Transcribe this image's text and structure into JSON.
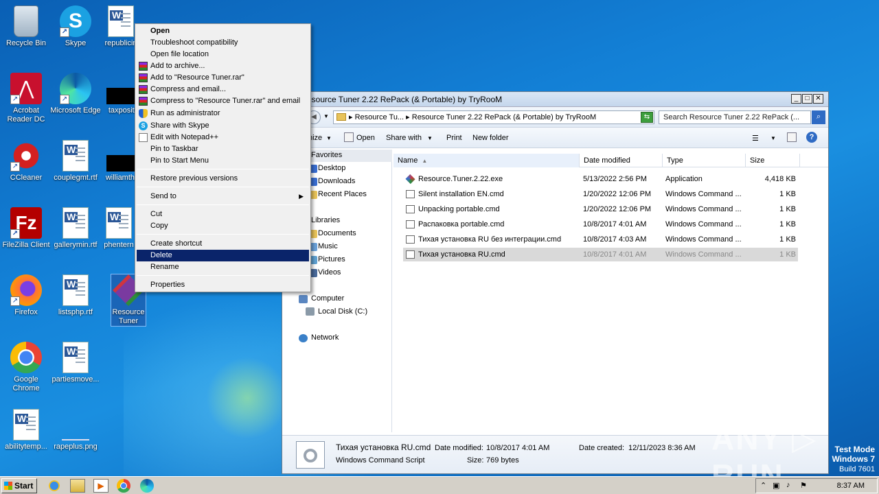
{
  "desktop": {
    "icons": [
      {
        "label": "Recycle Bin"
      },
      {
        "label": "Skype"
      },
      {
        "label": "republicin"
      },
      {
        "label": "Acrobat Reader DC"
      },
      {
        "label": "Microsoft Edge"
      },
      {
        "label": "taxpositi"
      },
      {
        "label": "CCleaner"
      },
      {
        "label": "couplegmt.rtf"
      },
      {
        "label": "williamthe"
      },
      {
        "label": "FileZilla Client"
      },
      {
        "label": "gallerymin.rtf"
      },
      {
        "label": "phentern"
      },
      {
        "label": "Firefox"
      },
      {
        "label": "listsphp.rtf"
      },
      {
        "label": "Resource Tuner"
      },
      {
        "label": "Google Chrome"
      },
      {
        "label": "partiesmove..."
      },
      {
        "label": "abilitytemp..."
      },
      {
        "label": "rapeplus.png"
      }
    ]
  },
  "context_menu": {
    "items": [
      {
        "label": "Open"
      },
      {
        "label": "Troubleshoot compatibility"
      },
      {
        "label": "Open file location"
      },
      {
        "label": "Add to archive..."
      },
      {
        "label": "Add to \"Resource Tuner.rar\""
      },
      {
        "label": "Compress and email..."
      },
      {
        "label": "Compress to \"Resource Tuner.rar\" and email"
      },
      {
        "label": "Run as administrator"
      },
      {
        "label": "Share with Skype"
      },
      {
        "label": "Edit with Notepad++"
      },
      {
        "label": "Pin to Taskbar"
      },
      {
        "label": "Pin to Start Menu"
      },
      {
        "label": "Restore previous versions"
      },
      {
        "label": "Send to"
      },
      {
        "label": "Cut"
      },
      {
        "label": "Copy"
      },
      {
        "label": "Create shortcut"
      },
      {
        "label": "Delete"
      },
      {
        "label": "Rename"
      },
      {
        "label": "Properties"
      }
    ]
  },
  "explorer": {
    "title": "esource Tuner 2.22 RePack (& Portable) by TryRooM",
    "address": "▸ Resource Tu... ▸ Resource Tuner 2.22 RePack (& Portable) by TryRooM",
    "search_placeholder": "Search Resource Tuner 2.22 RePack (...",
    "toolbar": {
      "organize": "nize",
      "open": "Open",
      "share": "Share with",
      "print": "Print",
      "new_folder": "New folder"
    },
    "nav": {
      "favorites": "Favorites",
      "desktop": "Desktop",
      "downloads": "Downloads",
      "recent": "Recent Places",
      "libraries": "Libraries",
      "documents": "Documents",
      "music": "Music",
      "pictures": "Pictures",
      "videos": "Videos",
      "computer": "Computer",
      "local_disk": "Local Disk (C:)",
      "network": "Network"
    },
    "columns": {
      "name": "Name",
      "date": "Date modified",
      "type": "Type",
      "size": "Size"
    },
    "files": [
      {
        "name": "Resource.Tuner.2.22.exe",
        "date": "5/13/2022 2:56 PM",
        "type": "Application",
        "size": "4,418 KB"
      },
      {
        "name": "Silent installation EN.cmd",
        "date": "1/20/2022 12:06 PM",
        "type": "Windows Command ...",
        "size": "1 KB"
      },
      {
        "name": "Unpacking portable.cmd",
        "date": "1/20/2022 12:06 PM",
        "type": "Windows Command ...",
        "size": "1 KB"
      },
      {
        "name": "Распаковка portable.cmd",
        "date": "10/8/2017 4:01 AM",
        "type": "Windows Command ...",
        "size": "1 KB"
      },
      {
        "name": "Тихая установка RU без интеграции.cmd",
        "date": "10/8/2017 4:03 AM",
        "type": "Windows Command ...",
        "size": "1 KB"
      },
      {
        "name": "Тихая установка RU.cmd",
        "date": "10/8/2017 4:01 AM",
        "type": "Windows Command ...",
        "size": "1 KB"
      }
    ],
    "details": {
      "name": "Тихая установка RU.cmd",
      "type": "Windows Command Script",
      "modified_label": "Date modified:",
      "modified": "10/8/2017 4:01 AM",
      "size_label": "Size:",
      "size": "769 bytes",
      "created_label": "Date created:",
      "created": "12/11/2023 8:36 AM"
    }
  },
  "taskbar": {
    "start": "Start",
    "clock": "8:37 AM"
  },
  "watermark": {
    "line1": "Test Mode",
    "line2": "Windows 7",
    "line3": "Build 7601",
    "brand": "ANY ▷ RUN"
  }
}
